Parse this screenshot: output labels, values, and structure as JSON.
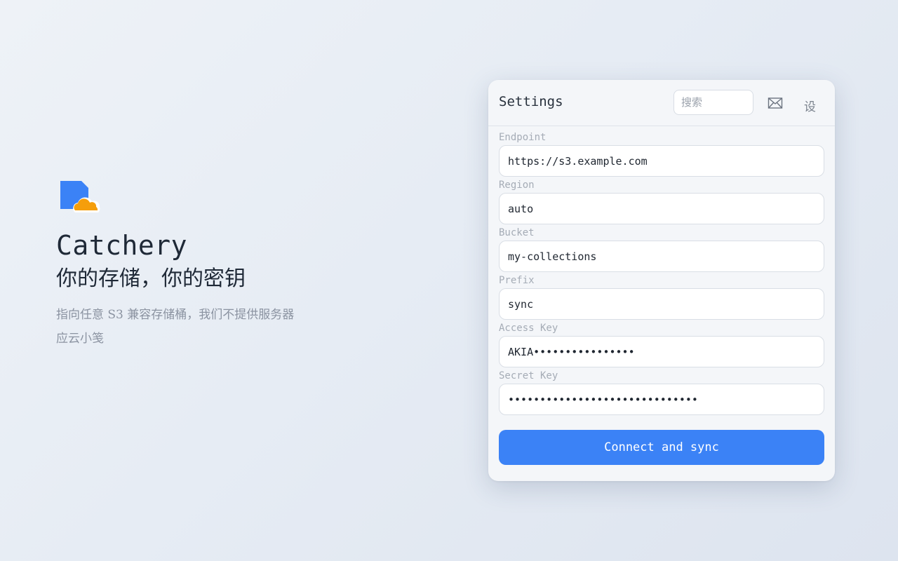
{
  "hero": {
    "app_name": "Catchery",
    "tagline": "你的存储，你的密钥",
    "subtitle_line1": "指向任意 S3 兼容存储桶，我们不提供服务器",
    "subtitle_line2": "应云小笺",
    "logo_icon": "file-cloud-logo",
    "colors": {
      "logo_doc": "#3b82f6",
      "logo_cloud": "#f59e0b"
    }
  },
  "settings": {
    "title": "Settings",
    "search_placeholder": "搜索",
    "mail_icon": "mail-icon",
    "settings_label": "设",
    "fields": [
      {
        "label": "Endpoint",
        "value": "https://s3.example.com"
      },
      {
        "label": "Region",
        "value": "auto"
      },
      {
        "label": "Bucket",
        "value": "my-collections"
      },
      {
        "label": "Prefix",
        "value": "sync"
      },
      {
        "label": "Access Key",
        "value": "AKIA••••••••••••••••"
      },
      {
        "label": "Secret Key",
        "value": "••••••••••••••••••••••••••••••"
      }
    ],
    "connect_label": "Connect and sync",
    "colors": {
      "accent": "#3b82f6"
    }
  }
}
